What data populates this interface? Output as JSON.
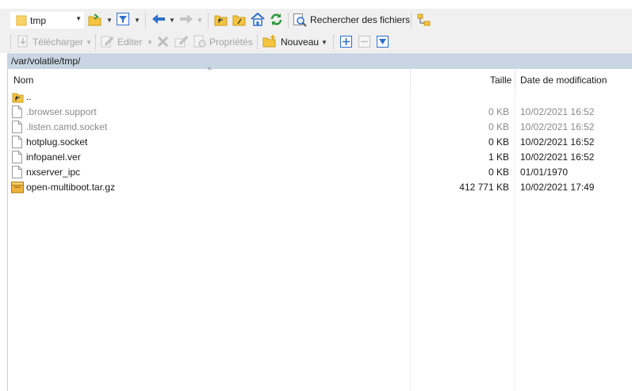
{
  "toolbar": {
    "location_value": "tmp",
    "search_label": "Rechercher des fichiers",
    "download_label": "Télécharger",
    "edit_label": "Editer",
    "properties_label": "Propriétés",
    "new_label": "Nouveau"
  },
  "path": "/var/volatile/tmp/",
  "columns": {
    "name": "Nom",
    "size": "Taille",
    "modified": "Date de modification"
  },
  "files": [
    {
      "name": "..",
      "size": "",
      "modified": "",
      "icon": "parent-folder-icon",
      "hidden": false
    },
    {
      "name": ".browser.support",
      "size": "0 KB",
      "modified": "10/02/2021 16:52",
      "icon": "file-icon",
      "hidden": true
    },
    {
      "name": ".listen.camd.socket",
      "size": "0 KB",
      "modified": "10/02/2021 16:52",
      "icon": "file-icon",
      "hidden": true
    },
    {
      "name": "hotplug.socket",
      "size": "0 KB",
      "modified": "10/02/2021 16:52",
      "icon": "file-icon",
      "hidden": false
    },
    {
      "name": "infopanel.ver",
      "size": "1 KB",
      "modified": "10/02/2021 16:52",
      "icon": "file-icon",
      "hidden": false
    },
    {
      "name": "nxserver_ipc",
      "size": "0 KB",
      "modified": "01/01/1970",
      "icon": "file-icon",
      "hidden": false
    },
    {
      "name": "open-multiboot.tar.gz",
      "size": "412 771 KB",
      "modified": "10/02/2021 17:49",
      "icon": "archive-icon",
      "hidden": false
    }
  ],
  "colors": {
    "path_bar": "#c9d5e3",
    "hidden_text": "#8a8a8a",
    "folder": "#f5c542",
    "refresh_green": "#2e9a3a",
    "nav_blue": "#2f6fc9"
  }
}
